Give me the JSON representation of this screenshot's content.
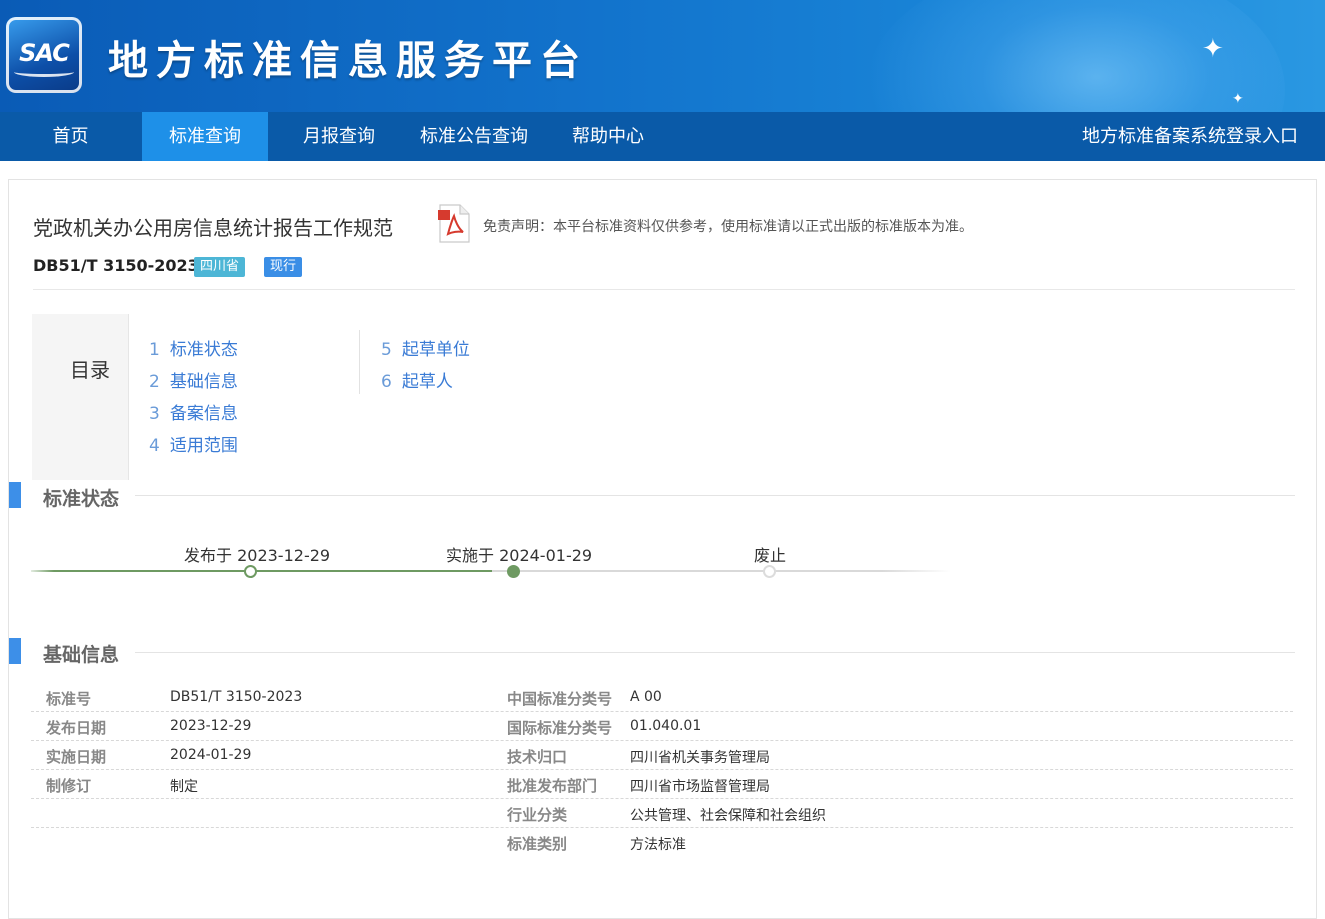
{
  "header": {
    "logo_text": "SAC",
    "site_title": "地方标准信息服务平台"
  },
  "nav": {
    "items": [
      {
        "label": "首页",
        "active": false
      },
      {
        "label": "标准查询",
        "active": true
      },
      {
        "label": "月报查询",
        "active": false
      },
      {
        "label": "标准公告查询",
        "active": false
      },
      {
        "label": "帮助中心",
        "active": false
      }
    ],
    "login": "地方标准备案系统登录入口"
  },
  "standard": {
    "title": "党政机关办公用房信息统计报告工作规范",
    "disclaimer": "免责声明：本平台标准资料仅供参考，使用标准请以正式出版的标准版本为准。",
    "code": "DB51/T 3150-2023",
    "province_tag": "四川省",
    "status_tag": "现行"
  },
  "toc": {
    "label": "目录",
    "items": [
      {
        "num": "1",
        "label": "标准状态"
      },
      {
        "num": "2",
        "label": "基础信息"
      },
      {
        "num": "3",
        "label": "备案信息"
      },
      {
        "num": "4",
        "label": "适用范围"
      },
      {
        "num": "5",
        "label": "起草单位"
      },
      {
        "num": "6",
        "label": "起草人"
      }
    ]
  },
  "status_section": {
    "title": "标准状态",
    "timeline": [
      {
        "label": "发布于 2023-12-29",
        "state": "passed"
      },
      {
        "label": "实施于 2024-01-29",
        "state": "current"
      },
      {
        "label": "废止",
        "state": "pending"
      }
    ]
  },
  "basic_section": {
    "title": "基础信息",
    "left": [
      {
        "key": "标准号",
        "value": "DB51/T 3150-2023"
      },
      {
        "key": "发布日期",
        "value": "2023-12-29"
      },
      {
        "key": "实施日期",
        "value": "2024-01-29"
      },
      {
        "key": "制修订",
        "value": "制定"
      }
    ],
    "right": [
      {
        "key": "中国标准分类号",
        "value": "A 00"
      },
      {
        "key": "国际标准分类号",
        "value": "01.040.01"
      },
      {
        "key": "技术归口",
        "value": "四川省机关事务管理局"
      },
      {
        "key": "批准发布部门",
        "value": "四川省市场监督管理局"
      },
      {
        "key": "行业分类",
        "value": "公共管理、社会保障和社会组织"
      },
      {
        "key": "标准类别",
        "value": "方法标准"
      }
    ]
  },
  "colors": {
    "nav_bg": "#0a5aa8",
    "nav_active": "#1e90e8",
    "timeline_done": "#6e9a62",
    "section_bar": "#3d8fe8"
  }
}
